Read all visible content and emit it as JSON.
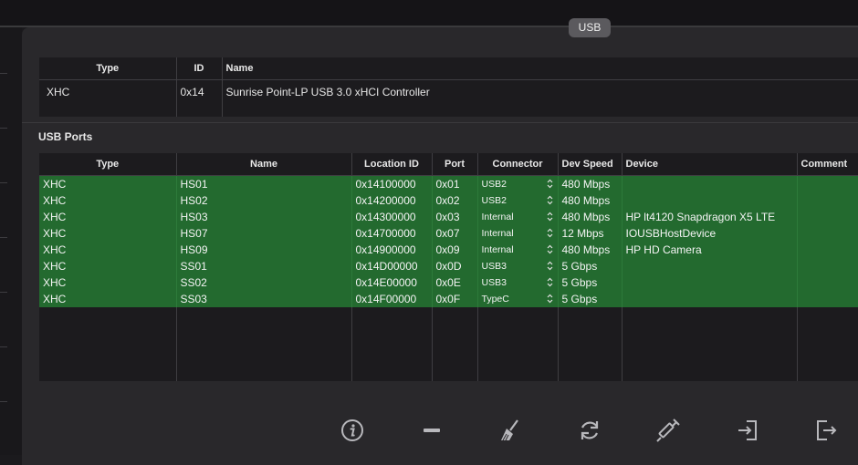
{
  "tab": {
    "label": "USB"
  },
  "controllers": {
    "headers": {
      "type": "Type",
      "id": "ID",
      "name": "Name"
    },
    "rows": [
      {
        "type": "XHC",
        "id": "0x14",
        "name": "Sunrise Point-LP USB 3.0 xHCI Controller"
      }
    ]
  },
  "usb_ports": {
    "section_title": "USB Ports",
    "headers": {
      "type": "Type",
      "name": "Name",
      "location_id": "Location ID",
      "port": "Port",
      "connector": "Connector",
      "dev_speed": "Dev Speed",
      "device": "Device",
      "comment": "Comment"
    },
    "rows": [
      {
        "type": "XHC",
        "name": "HS01",
        "location_id": "0x14100000",
        "port": "0x01",
        "connector": "USB2",
        "dev_speed": "480 Mbps",
        "device": "",
        "comment": ""
      },
      {
        "type": "XHC",
        "name": "HS02",
        "location_id": "0x14200000",
        "port": "0x02",
        "connector": "USB2",
        "dev_speed": "480 Mbps",
        "device": "",
        "comment": ""
      },
      {
        "type": "XHC",
        "name": "HS03",
        "location_id": "0x14300000",
        "port": "0x03",
        "connector": "Internal",
        "dev_speed": "480 Mbps",
        "device": "HP lt4120 Snapdragon X5 LTE",
        "comment": ""
      },
      {
        "type": "XHC",
        "name": "HS07",
        "location_id": "0x14700000",
        "port": "0x07",
        "connector": "Internal",
        "dev_speed": "12 Mbps",
        "device": "IOUSBHostDevice",
        "comment": ""
      },
      {
        "type": "XHC",
        "name": "HS09",
        "location_id": "0x14900000",
        "port": "0x09",
        "connector": "Internal",
        "dev_speed": "480 Mbps",
        "device": "HP HD Camera",
        "comment": ""
      },
      {
        "type": "XHC",
        "name": "SS01",
        "location_id": "0x14D00000",
        "port": "0x0D",
        "connector": "USB3",
        "dev_speed": "5 Gbps",
        "device": "",
        "comment": ""
      },
      {
        "type": "XHC",
        "name": "SS02",
        "location_id": "0x14E00000",
        "port": "0x0E",
        "connector": "USB3",
        "dev_speed": "5 Gbps",
        "device": "",
        "comment": ""
      },
      {
        "type": "XHC",
        "name": "SS03",
        "location_id": "0x14F00000",
        "port": "0x0F",
        "connector": "TypeC",
        "dev_speed": "5 Gbps",
        "device": "",
        "comment": ""
      }
    ]
  },
  "toolbar": {
    "icons": [
      "info-icon",
      "remove-icon",
      "broom-icon",
      "refresh-icon",
      "syringe-icon",
      "import-icon",
      "export-icon"
    ]
  },
  "colors": {
    "selected_row": "#236a2f",
    "panel": "#29282b",
    "table_bg": "#1c1b1e"
  }
}
